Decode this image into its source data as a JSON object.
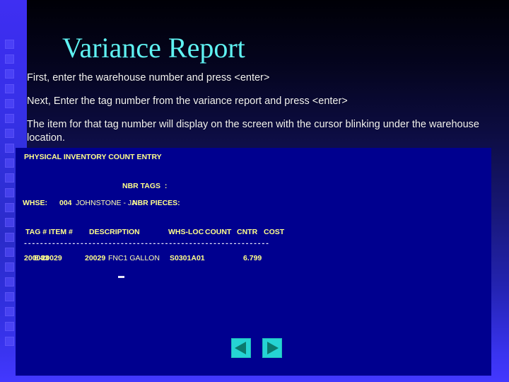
{
  "slide": {
    "title": "Variance Report",
    "title_color": "#5ff2f2",
    "background_color": "#00008f",
    "bullets": [
      "First, enter the warehouse number and press <enter>",
      "Next, Enter the tag number from the variance report and press <enter>",
      "The item for that tag number will display on the screen with the cursor blinking under the warehouse location."
    ]
  },
  "terminal": {
    "screen_title": "PHYSICAL INVENTORY COUNT ENTRY",
    "text_color": "#ffff8c",
    "nbr_tags_label": "NBR TAGS  :",
    "nbr_tags_value": "",
    "whse_label": "WHSE:",
    "whse_number": "004",
    "whse_name": "JOHNSTONE - JA",
    "nbr_pieces_label": "NBR PIECES:",
    "nbr_pieces_value": "",
    "columns": {
      "tag": "TAG #",
      "item": "ITEM #",
      "description": "DESCRIPTION",
      "whsloc": "WHS-LOC",
      "count": "COUNT",
      "cntr": "CNTR",
      "cost": "COST"
    },
    "separator": "-------------------------------------------------------------",
    "row": {
      "tag": "200083",
      "item_overlay": "E-20029",
      "item": "20029",
      "description": "FNC1 GALLON",
      "whsloc": "S0301A01",
      "count": "",
      "cntr": "",
      "cost": "6.799"
    }
  },
  "nav": {
    "previous_label": "previous-slide",
    "next_label": "next-slide",
    "button_color": "#25d4d4",
    "arrow_color": "#0a7a6e"
  }
}
